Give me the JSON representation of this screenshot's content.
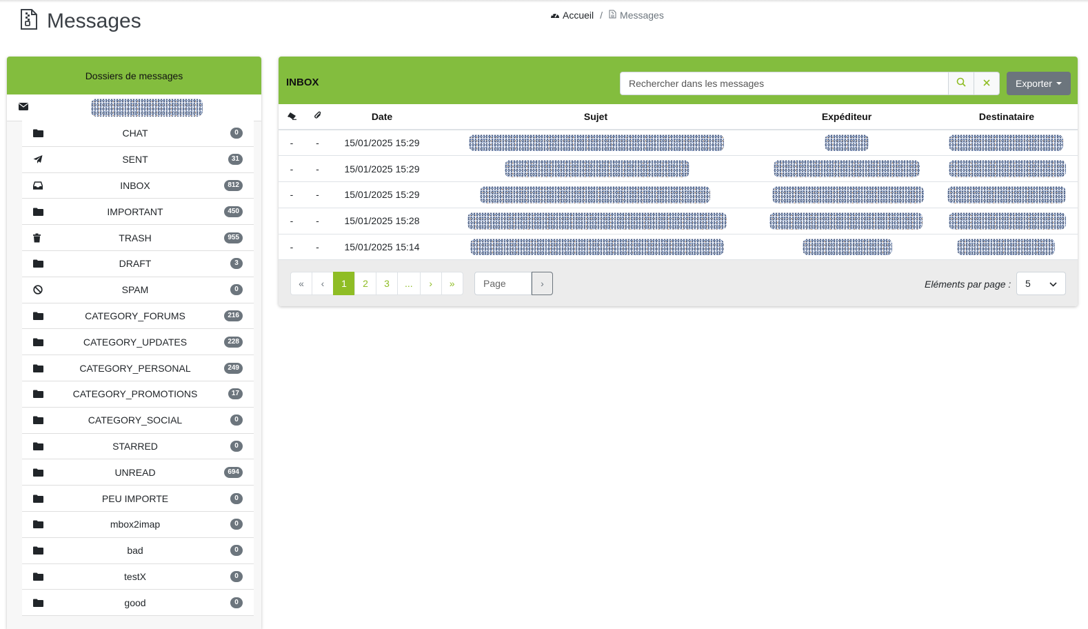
{
  "header": {
    "title": "Messages"
  },
  "breadcrumb": {
    "home": "Accueil",
    "current": "Messages"
  },
  "folders": {
    "heading": "Dossiers de messages",
    "items": [
      {
        "icon": "folder-icon",
        "name": "CHAT",
        "count": "0"
      },
      {
        "icon": "paper-plane-icon",
        "name": "SENT",
        "count": "31"
      },
      {
        "icon": "inbox-tray-icon",
        "name": "INBOX",
        "count": "812"
      },
      {
        "icon": "folder-icon",
        "name": "IMPORTANT",
        "count": "450"
      },
      {
        "icon": "trash-icon",
        "name": "TRASH",
        "count": "955"
      },
      {
        "icon": "folder-icon",
        "name": "DRAFT",
        "count": "3"
      },
      {
        "icon": "ban-icon",
        "name": "SPAM",
        "count": "0"
      },
      {
        "icon": "folder-icon",
        "name": "CATEGORY_FORUMS",
        "count": "216"
      },
      {
        "icon": "folder-icon",
        "name": "CATEGORY_UPDATES",
        "count": "228"
      },
      {
        "icon": "folder-icon",
        "name": "CATEGORY_PERSONAL",
        "count": "249"
      },
      {
        "icon": "folder-icon",
        "name": "CATEGORY_PROMOTIONS",
        "count": "17"
      },
      {
        "icon": "folder-icon",
        "name": "CATEGORY_SOCIAL",
        "count": "0"
      },
      {
        "icon": "folder-icon",
        "name": "STARRED",
        "count": "0"
      },
      {
        "icon": "folder-icon",
        "name": "UNREAD",
        "count": "694"
      },
      {
        "icon": "folder-icon",
        "name": "PEU IMPORTE",
        "count": "0"
      },
      {
        "icon": "folder-icon",
        "name": "mbox2imap",
        "count": "0"
      },
      {
        "icon": "folder-icon",
        "name": "bad",
        "count": "0"
      },
      {
        "icon": "folder-icon",
        "name": "testX",
        "count": "0"
      },
      {
        "icon": "folder-icon",
        "name": "good",
        "count": "0"
      }
    ]
  },
  "inbox": {
    "title": "INBOX",
    "search_placeholder": "Rechercher dans les messages",
    "export_label": "Exporter",
    "columns": {
      "read": "",
      "attachment": "",
      "date": "Date",
      "subject": "Sujet",
      "sender": "Expéditeur",
      "recipient": "Destinataire"
    },
    "rows": [
      {
        "read": "-",
        "attachment": "-",
        "date": "15/01/2025 15:29"
      },
      {
        "read": "-",
        "attachment": "-",
        "date": "15/01/2025 15:29"
      },
      {
        "read": "-",
        "attachment": "-",
        "date": "15/01/2025 15:29"
      },
      {
        "read": "-",
        "attachment": "-",
        "date": "15/01/2025 15:28"
      },
      {
        "read": "-",
        "attachment": "-",
        "date": "15/01/2025 15:14"
      }
    ],
    "pagination": {
      "first": "«",
      "prev": "‹",
      "pages": [
        "1",
        "2",
        "3"
      ],
      "active_page": "1",
      "ellipsis": "...",
      "next": "›",
      "last": "»",
      "page_placeholder": "Page",
      "go": "›"
    },
    "per_page_label": "Eléments par page :",
    "per_page_value": "5"
  },
  "colors": {
    "accent": "#83bd3e",
    "pagination": "#8fbd25",
    "badge": "#6c757d"
  }
}
